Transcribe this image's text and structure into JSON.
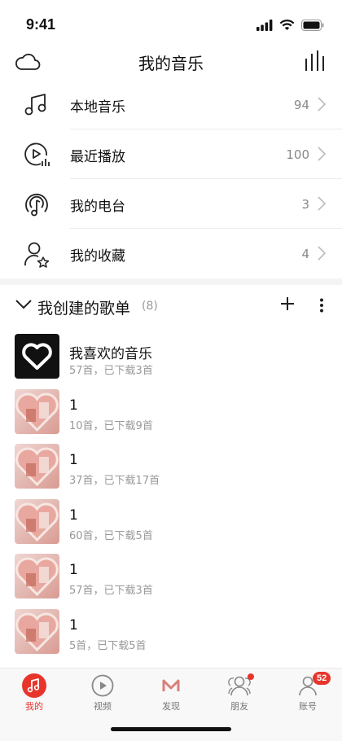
{
  "status": {
    "time": "9:41"
  },
  "nav": {
    "title": "我的音乐"
  },
  "menu": [
    {
      "label": "本地音乐",
      "count": "94",
      "icon": "music-note-icon"
    },
    {
      "label": "最近播放",
      "count": "100",
      "icon": "recent-play-icon"
    },
    {
      "label": "我的电台",
      "count": "3",
      "icon": "radio-icon"
    },
    {
      "label": "我的收藏",
      "count": "4",
      "icon": "favorite-user-icon"
    }
  ],
  "playlists_header": {
    "title": "我创建的歌单",
    "count": "(8)"
  },
  "playlists": [
    {
      "title": "我喜欢的音乐",
      "subtitle": "57首，已下载3首",
      "cover": "heart-icon"
    },
    {
      "title": "1",
      "subtitle": "10首，已下载9首",
      "cover": "photo"
    },
    {
      "title": "1",
      "subtitle": "37首，已下载17首",
      "cover": "photo"
    },
    {
      "title": "1",
      "subtitle": "60首，已下载5首",
      "cover": "photo"
    },
    {
      "title": "1",
      "subtitle": "57首，已下载3首",
      "cover": "photo"
    },
    {
      "title": "1",
      "subtitle": "5首，已下载5首",
      "cover": "photo"
    }
  ],
  "tabs": [
    {
      "label": "我的",
      "icon": "music-note-icon",
      "active": true
    },
    {
      "label": "视频",
      "icon": "video-play-icon"
    },
    {
      "label": "发现",
      "icon": "discover-logo-icon"
    },
    {
      "label": "朋友",
      "icon": "friends-icon",
      "dot": true
    },
    {
      "label": "账号",
      "icon": "account-icon",
      "badge": "52"
    }
  ],
  "colors": {
    "accent": "#e8352c",
    "text": "#111111",
    "secondary": "#999999"
  }
}
